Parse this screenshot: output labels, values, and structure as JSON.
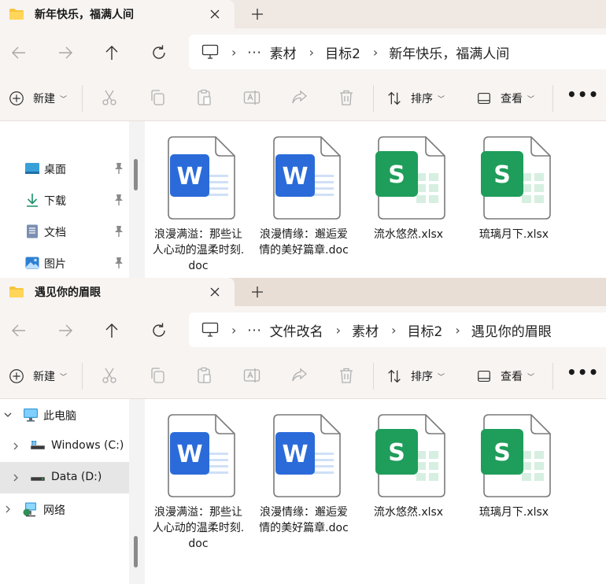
{
  "windows": [
    {
      "tab_title": "新年快乐，福满人间",
      "breadcrumbs": [
        "素材",
        "目标2",
        "新年快乐，福满人间"
      ],
      "toolbar": {
        "new_label": "新建",
        "sort_label": "排序",
        "view_label": "查看",
        "more_label": "•••"
      },
      "sidebar": [
        {
          "label": "桌面",
          "icon": "desktop-icon",
          "pinned": true
        },
        {
          "label": "下载",
          "icon": "download-icon",
          "pinned": true
        },
        {
          "label": "文档",
          "icon": "document-icon",
          "pinned": true
        },
        {
          "label": "图片",
          "icon": "picture-icon",
          "pinned": true
        }
      ],
      "files": [
        {
          "name": "浪漫满溢：那些让人心动的温柔时刻.doc",
          "type": "word"
        },
        {
          "name": "浪漫情缘：邂逅爱情的美好篇章.doc",
          "type": "word"
        },
        {
          "name": "流水悠然.xlsx",
          "type": "excel"
        },
        {
          "name": "琉璃月下.xlsx",
          "type": "excel"
        }
      ]
    },
    {
      "tab_title": "遇见你的眉眼",
      "breadcrumbs": [
        "文件改名",
        "素材",
        "目标2",
        "遇见你的眉眼"
      ],
      "toolbar": {
        "new_label": "新建",
        "sort_label": "排序",
        "view_label": "查看",
        "more_label": "•••"
      },
      "sidebar": [
        {
          "label": "此电脑",
          "icon": "computer-icon",
          "expanded": true
        },
        {
          "label": "Windows (C:)",
          "icon": "drive-icon",
          "expanded": false
        },
        {
          "label": "Data (D:)",
          "icon": "drive-icon",
          "expanded": false,
          "selected": true
        },
        {
          "label": "网络",
          "icon": "network-icon",
          "expanded": false
        }
      ],
      "files": [
        {
          "name": "浪漫满溢：那些让人心动的温柔时刻.doc",
          "type": "word"
        },
        {
          "name": "浪漫情缘：邂逅爱情的美好篇章.doc",
          "type": "word"
        },
        {
          "name": "流水悠然.xlsx",
          "type": "excel"
        },
        {
          "name": "琉璃月下.xlsx",
          "type": "excel"
        }
      ]
    }
  ],
  "icon_text": {
    "word_letter": "W",
    "excel_letter": "S"
  },
  "colors": {
    "word_blue": "#2b6bd9",
    "excel_green": "#1f9d5b",
    "folder_yellow": "#f5c53c",
    "selected_bg": "#e6e6e6"
  }
}
